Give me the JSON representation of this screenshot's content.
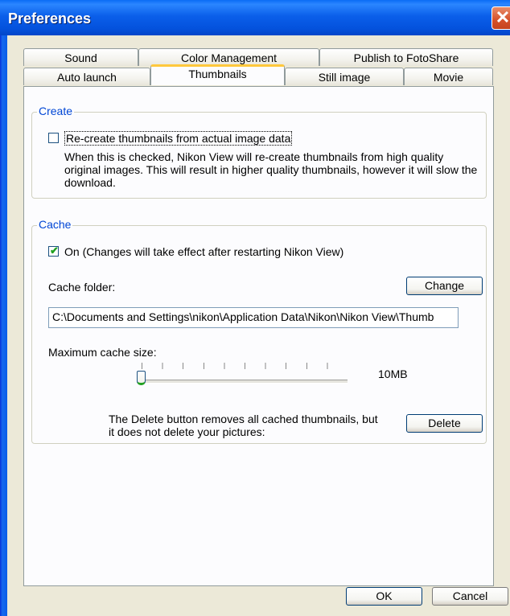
{
  "window": {
    "title": "Preferences",
    "close_symbol": "✕"
  },
  "tabs": {
    "row1": [
      "Sound",
      "Color Management",
      "Publish to FotoShare"
    ],
    "row2": [
      "Auto launch",
      "Thumbnails",
      "Still image",
      "Movie"
    ],
    "active": "Thumbnails"
  },
  "create_group": {
    "legend": "Create",
    "checkbox_label": "Re-create thumbnails from actual image data",
    "checked": false,
    "description": "When this is checked, Nikon View will re-create thumbnails from high quality original images. This will result in higher quality thumbnails, however it will slow the download."
  },
  "cache_group": {
    "legend": "Cache",
    "on_checkbox_label": "On (Changes will take effect after restarting Nikon View)",
    "on_checked": true,
    "cache_folder_label": "Cache folder:",
    "change_button": "Change",
    "cache_folder_value": "C:\\Documents and Settings\\nikon\\Application Data\\Nikon\\Nikon View\\Thumb",
    "max_size_label": "Maximum cache size:",
    "max_size_value": "10MB",
    "slider_position_fraction": 0.0,
    "delete_note": "The Delete button removes all cached thumbnails, but it does not delete your pictures:",
    "delete_button": "Delete"
  },
  "footer": {
    "ok_button": "OK",
    "cancel_button": "Cancel"
  }
}
